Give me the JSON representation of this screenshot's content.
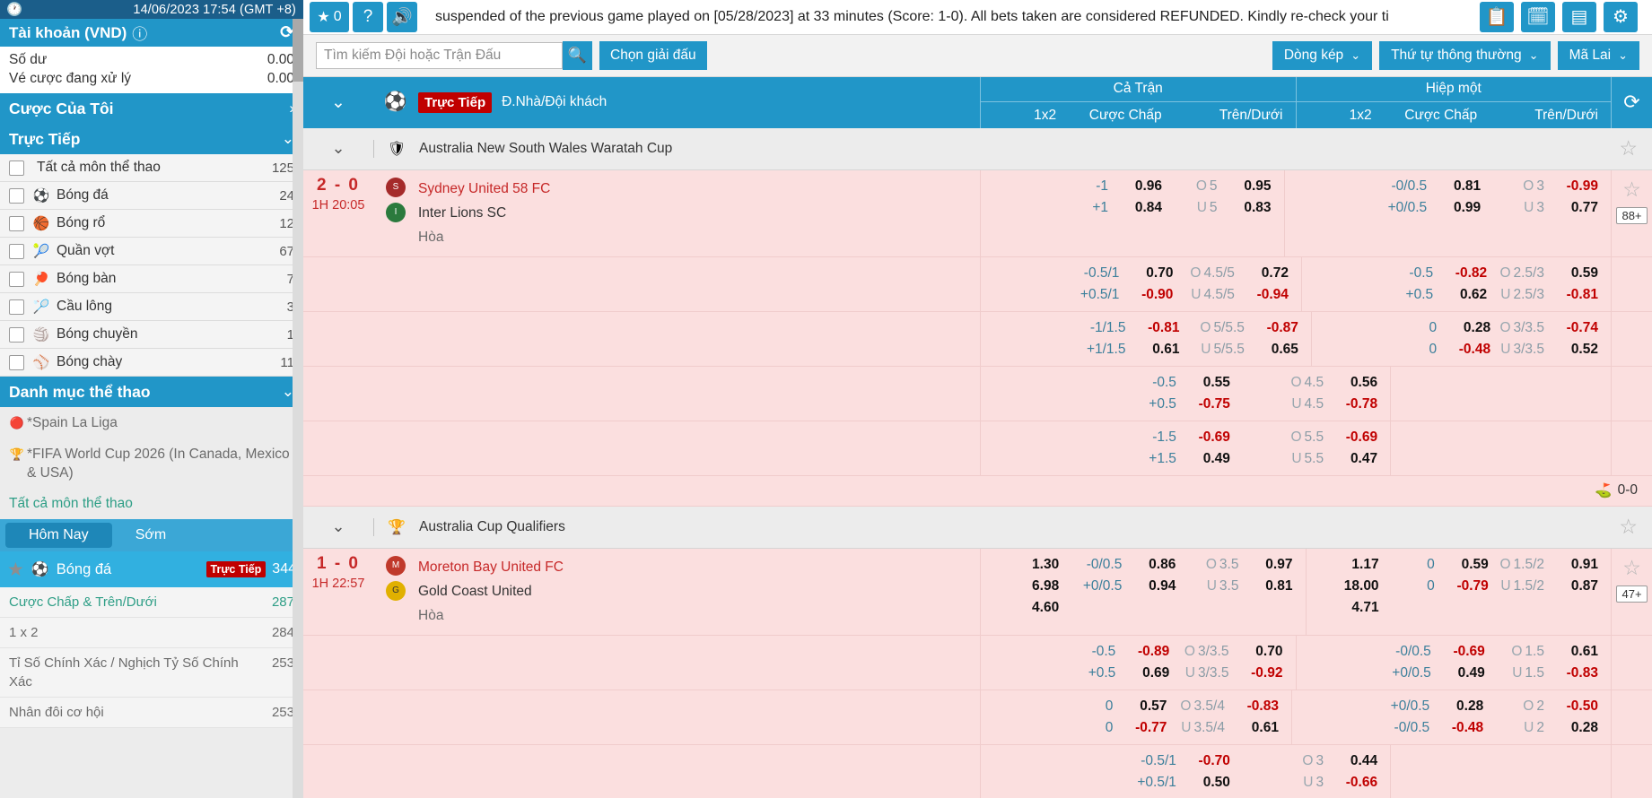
{
  "sidebar": {
    "clock": {
      "icon": "clock-icon",
      "time": "14/06/2023 17:54 (GMT +8)"
    },
    "account": {
      "title": "Tài khoản (VND)",
      "info_icon": "info-icon",
      "refresh_icon": "refresh-icon",
      "rows": [
        {
          "label": "Số dư",
          "value": "0.00"
        },
        {
          "label": "Vé cược đang xử lý",
          "value": "0.00"
        }
      ]
    },
    "my_bets": {
      "label": "Cược Của Tôi",
      "chevron": "chevron-right-icon"
    },
    "live": {
      "label": "Trực Tiếp",
      "chevron": "chevron-down-icon"
    },
    "sports": [
      {
        "label": "Tất cả môn thể thao",
        "count": "125",
        "icon": ""
      },
      {
        "label": "Bóng đá",
        "count": "24",
        "icon": "soccer-ball-icon",
        "glyph": "⚽"
      },
      {
        "label": "Bóng rổ",
        "count": "12",
        "icon": "basketball-icon",
        "glyph": "🏀"
      },
      {
        "label": "Quần vợt",
        "count": "67",
        "icon": "tennis-icon",
        "glyph": "🎾"
      },
      {
        "label": "Bóng bàn",
        "count": "7",
        "icon": "table-tennis-icon",
        "glyph": "🏓"
      },
      {
        "label": "Cầu lông",
        "count": "3",
        "icon": "badminton-icon",
        "glyph": "🏸"
      },
      {
        "label": "Bóng chuyền",
        "count": "1",
        "icon": "volleyball-icon",
        "glyph": "🏐"
      },
      {
        "label": "Bóng chày",
        "count": "11",
        "icon": "baseball-icon",
        "glyph": "⚾"
      }
    ],
    "sport_catalog": {
      "label": "Danh mục thể thao",
      "chevron": "chevron-down-icon"
    },
    "leagues": [
      {
        "label": "*Spain La Liga",
        "icon": "laliga-logo-icon"
      },
      {
        "label": "*FIFA World Cup 2026 (In Canada, Mexico & USA)",
        "icon": "fifa-trophy-icon"
      }
    ],
    "all_sports_link": "Tất cả môn thể thao",
    "day_tabs": [
      {
        "label": "Hôm Nay",
        "active": true
      },
      {
        "label": "Sớm",
        "active": false
      }
    ],
    "selected_sport": {
      "star_icon": "star-icon",
      "ball_icon": "soccer-ball-icon",
      "label": "Bóng đá",
      "badge": "Trực Tiếp",
      "count": "344"
    },
    "bet_types": [
      {
        "label": "Cược Chấp & Trên/Dưới",
        "count": "287",
        "highlight": true
      },
      {
        "label": "1 x 2",
        "count": "284",
        "highlight": false
      },
      {
        "label": "Tỉ Số Chính Xác / Nghịch Tỷ Số Chính Xác",
        "count": "253",
        "highlight": false
      },
      {
        "label": "Nhân đôi cơ hội",
        "count": "253",
        "highlight": false
      }
    ]
  },
  "topbar": {
    "fav_icon": "star-icon",
    "fav_count": "0",
    "help_icon": "question-mark-icon",
    "sound_icon": "speaker-icon",
    "ticker": "suspended of the previous game played on [05/28/2023] at 33 minutes (Score: 1-0). All bets taken are considered REFUNDED. Kindly re-check your ti",
    "right_icons": [
      {
        "name": "bet-list-icon",
        "glyph": "▤"
      },
      {
        "name": "bet-history-icon",
        "glyph": "▦"
      },
      {
        "name": "results-icon",
        "glyph": "▤"
      },
      {
        "name": "settings-gear-icon",
        "glyph": "⚙"
      }
    ]
  },
  "searchbar": {
    "placeholder": "Tìm kiếm Đội hoặc Trận Đấu",
    "value": "",
    "search_icon": "search-icon",
    "league_button": "Chọn giải đấu",
    "dropdowns": [
      {
        "label": "Dòng kép",
        "name": "line-mode-dropdown"
      },
      {
        "label": "Thứ tự thông thường",
        "name": "sort-order-dropdown"
      },
      {
        "label": "Mã Lai",
        "name": "odds-format-dropdown"
      }
    ]
  },
  "board": {
    "header": {
      "chevron": "chevron-down-icon",
      "ball_icon": "soccer-ball-icon",
      "live_badge": "Trực Tiếp",
      "home_away": "Đ.Nhà/Đội khách",
      "refresh_icon": "refresh-icon",
      "groups": [
        {
          "title": "Cả Trận",
          "cols": [
            "1x2",
            "Cược Chấp",
            "Trên/Dưới"
          ]
        },
        {
          "title": "Hiệp một",
          "cols": [
            "1x2",
            "Cược Chấp",
            "Trên/Dưới"
          ]
        }
      ]
    },
    "leagues": [
      {
        "name": "Australia New South Wales Waratah Cup",
        "flag": "waratah-cup-logo-icon",
        "chevron": "chevron-down-icon",
        "star_icon": "star-icon",
        "matches": [
          {
            "score": "2 - 0",
            "time": "1H 20:05",
            "team_home": "Sydney United 58 FC",
            "team_away": "Inter Lions SC",
            "draw_label": "Hòa",
            "star_icon": "star-icon",
            "more_badge": "88+",
            "rows": [
              {
                "fulltime": {
                  "c1": [],
                  "c2": [
                    {
                      "hcp": "-1",
                      "val": "0.96",
                      "neg": false
                    },
                    {
                      "hcp": "+1",
                      "val": "0.84",
                      "neg": false
                    }
                  ],
                  "c3": [
                    {
                      "hcp": "5",
                      "sym": "O",
                      "val": "0.95",
                      "neg": false
                    },
                    {
                      "hcp": "5",
                      "sym": "U",
                      "val": "0.83",
                      "neg": false
                    }
                  ]
                },
                "firsthalf": {
                  "c1": [],
                  "c2": [
                    {
                      "hcp": "-0/0.5",
                      "val": "0.81",
                      "neg": false
                    },
                    {
                      "hcp": "+0/0.5",
                      "val": "0.99",
                      "neg": false
                    }
                  ],
                  "c3": [
                    {
                      "hcp": "3",
                      "sym": "O",
                      "val": "-0.99",
                      "neg": true
                    },
                    {
                      "hcp": "3",
                      "sym": "U",
                      "val": "0.77",
                      "neg": false
                    }
                  ]
                }
              },
              {
                "fulltime": {
                  "c1": [],
                  "c2": [
                    {
                      "hcp": "-0.5/1",
                      "val": "0.70",
                      "neg": false
                    },
                    {
                      "hcp": "+0.5/1",
                      "val": "-0.90",
                      "neg": true
                    }
                  ],
                  "c3": [
                    {
                      "hcp": "4.5/5",
                      "sym": "O",
                      "val": "0.72",
                      "neg": false
                    },
                    {
                      "hcp": "4.5/5",
                      "sym": "U",
                      "val": "-0.94",
                      "neg": true
                    }
                  ]
                },
                "firsthalf": {
                  "c1": [],
                  "c2": [
                    {
                      "hcp": "-0.5",
                      "val": "-0.82",
                      "neg": true
                    },
                    {
                      "hcp": "+0.5",
                      "val": "0.62",
                      "neg": false
                    }
                  ],
                  "c3": [
                    {
                      "hcp": "2.5/3",
                      "sym": "O",
                      "val": "0.59",
                      "neg": false
                    },
                    {
                      "hcp": "2.5/3",
                      "sym": "U",
                      "val": "-0.81",
                      "neg": true
                    }
                  ]
                }
              },
              {
                "fulltime": {
                  "c1": [],
                  "c2": [
                    {
                      "hcp": "-1/1.5",
                      "val": "-0.81",
                      "neg": true
                    },
                    {
                      "hcp": "+1/1.5",
                      "val": "0.61",
                      "neg": false
                    }
                  ],
                  "c3": [
                    {
                      "hcp": "5/5.5",
                      "sym": "O",
                      "val": "-0.87",
                      "neg": true
                    },
                    {
                      "hcp": "5/5.5",
                      "sym": "U",
                      "val": "0.65",
                      "neg": false
                    }
                  ]
                },
                "firsthalf": {
                  "c1": [],
                  "c2": [
                    {
                      "hcp": "0",
                      "val": "0.28",
                      "neg": false
                    },
                    {
                      "hcp": "0",
                      "val": "-0.48",
                      "neg": true
                    }
                  ],
                  "c3": [
                    {
                      "hcp": "3/3.5",
                      "sym": "O",
                      "val": "-0.74",
                      "neg": true
                    },
                    {
                      "hcp": "3/3.5",
                      "sym": "U",
                      "val": "0.52",
                      "neg": false
                    }
                  ]
                }
              },
              {
                "fulltime": {
                  "c1": [],
                  "c2": [
                    {
                      "hcp": "-0.5",
                      "val": "0.55",
                      "neg": false
                    },
                    {
                      "hcp": "+0.5",
                      "val": "-0.75",
                      "neg": true
                    }
                  ],
                  "c3": [
                    {
                      "hcp": "4.5",
                      "sym": "O",
                      "val": "0.56",
                      "neg": false
                    },
                    {
                      "hcp": "4.5",
                      "sym": "U",
                      "val": "-0.78",
                      "neg": true
                    }
                  ]
                },
                "firsthalf": {
                  "c1": [],
                  "c2": [],
                  "c3": []
                }
              },
              {
                "fulltime": {
                  "c1": [],
                  "c2": [
                    {
                      "hcp": "-1.5",
                      "val": "-0.69",
                      "neg": true
                    },
                    {
                      "hcp": "+1.5",
                      "val": "0.49",
                      "neg": false
                    }
                  ],
                  "c3": [
                    {
                      "hcp": "5.5",
                      "sym": "O",
                      "val": "-0.69",
                      "neg": true
                    },
                    {
                      "hcp": "5.5",
                      "sym": "U",
                      "val": "0.47",
                      "neg": false
                    }
                  ]
                },
                "firsthalf": {
                  "c1": [],
                  "c2": [],
                  "c3": []
                }
              }
            ],
            "footer": {
              "icon": "corner-flag-icon",
              "text": "0-0"
            }
          }
        ]
      },
      {
        "name": "Australia Cup Qualifiers",
        "flag": "australia-cup-logo-icon",
        "chevron": "chevron-down-icon",
        "star_icon": "star-icon",
        "matches": [
          {
            "score": "1 - 0",
            "time": "1H 22:57",
            "team_home": "Moreton Bay United FC",
            "team_away": "Gold Coast United",
            "draw_label": "Hòa",
            "star_icon": "star-icon",
            "more_badge": "47+",
            "rows": [
              {
                "fulltime": {
                  "c1": [
                    {
                      "val": "1.30"
                    },
                    {
                      "val": "6.98"
                    },
                    {
                      "val": "4.60"
                    }
                  ],
                  "c2": [
                    {
                      "hcp": "-0/0.5",
                      "val": "0.86",
                      "neg": false
                    },
                    {
                      "hcp": "+0/0.5",
                      "val": "0.94",
                      "neg": false
                    }
                  ],
                  "c3": [
                    {
                      "hcp": "3.5",
                      "sym": "O",
                      "val": "0.97",
                      "neg": false
                    },
                    {
                      "hcp": "3.5",
                      "sym": "U",
                      "val": "0.81",
                      "neg": false
                    }
                  ]
                },
                "firsthalf": {
                  "c1": [
                    {
                      "val": "1.17"
                    },
                    {
                      "val": "18.00"
                    },
                    {
                      "val": "4.71"
                    }
                  ],
                  "c2": [
                    {
                      "hcp": "0",
                      "val": "0.59",
                      "neg": false
                    },
                    {
                      "hcp": "0",
                      "val": "-0.79",
                      "neg": true
                    }
                  ],
                  "c3": [
                    {
                      "hcp": "1.5/2",
                      "sym": "O",
                      "val": "0.91",
                      "neg": false
                    },
                    {
                      "hcp": "1.5/2",
                      "sym": "U",
                      "val": "0.87",
                      "neg": false
                    }
                  ]
                }
              },
              {
                "fulltime": {
                  "c1": [],
                  "c2": [
                    {
                      "hcp": "-0.5",
                      "val": "-0.89",
                      "neg": true
                    },
                    {
                      "hcp": "+0.5",
                      "val": "0.69",
                      "neg": false
                    }
                  ],
                  "c3": [
                    {
                      "hcp": "3/3.5",
                      "sym": "O",
                      "val": "0.70",
                      "neg": false
                    },
                    {
                      "hcp": "3/3.5",
                      "sym": "U",
                      "val": "-0.92",
                      "neg": true
                    }
                  ]
                },
                "firsthalf": {
                  "c1": [],
                  "c2": [
                    {
                      "hcp": "-0/0.5",
                      "val": "-0.69",
                      "neg": true
                    },
                    {
                      "hcp": "+0/0.5",
                      "val": "0.49",
                      "neg": false
                    }
                  ],
                  "c3": [
                    {
                      "hcp": "1.5",
                      "sym": "O",
                      "val": "0.61",
                      "neg": false
                    },
                    {
                      "hcp": "1.5",
                      "sym": "U",
                      "val": "-0.83",
                      "neg": true
                    }
                  ]
                }
              },
              {
                "fulltime": {
                  "c1": [],
                  "c2": [
                    {
                      "hcp": "0",
                      "val": "0.57",
                      "neg": false
                    },
                    {
                      "hcp": "0",
                      "val": "-0.77",
                      "neg": true
                    }
                  ],
                  "c3": [
                    {
                      "hcp": "3.5/4",
                      "sym": "O",
                      "val": "-0.83",
                      "neg": true
                    },
                    {
                      "hcp": "3.5/4",
                      "sym": "U",
                      "val": "0.61",
                      "neg": false
                    }
                  ]
                },
                "firsthalf": {
                  "c1": [],
                  "c2": [
                    {
                      "hcp": "+0/0.5",
                      "val": "0.28",
                      "neg": false
                    },
                    {
                      "hcp": "-0/0.5",
                      "val": "-0.48",
                      "neg": true
                    }
                  ],
                  "c3": [
                    {
                      "hcp": "2",
                      "sym": "O",
                      "val": "-0.50",
                      "neg": true
                    },
                    {
                      "hcp": "2",
                      "sym": "U",
                      "val": "0.28",
                      "neg": false
                    }
                  ]
                }
              },
              {
                "fulltime": {
                  "c1": [],
                  "c2": [
                    {
                      "hcp": "-0.5/1",
                      "val": "-0.70",
                      "neg": true
                    },
                    {
                      "hcp": "+0.5/1",
                      "val": "0.50",
                      "neg": false
                    }
                  ],
                  "c3": [
                    {
                      "hcp": "3",
                      "sym": "O",
                      "val": "0.44",
                      "neg": false
                    },
                    {
                      "hcp": "3",
                      "sym": "U",
                      "val": "-0.66",
                      "neg": true
                    }
                  ]
                },
                "firsthalf": {
                  "c1": [],
                  "c2": [],
                  "c3": []
                }
              }
            ],
            "footer": null
          }
        ]
      }
    ]
  }
}
